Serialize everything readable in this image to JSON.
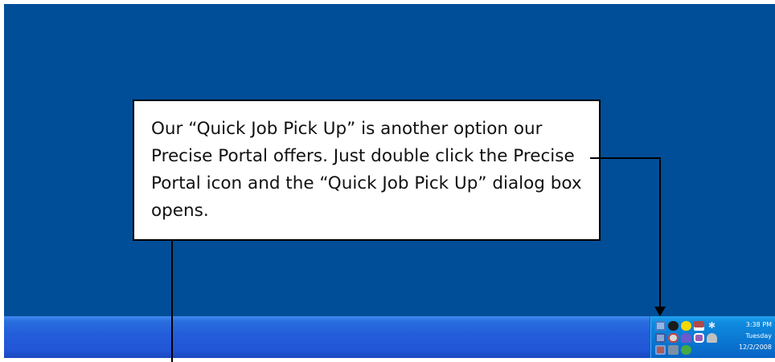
{
  "callout": {
    "text": "Our “Quick Job Pick Up” is another option our Precise Portal offers. Just double click the Precise Portal icon and the “Quick Job Pick Up” dialog box opens."
  },
  "clock": {
    "time": "3:38 PM",
    "day": "Tuesday",
    "date": "12/2/2008"
  },
  "tray_icons": [
    {
      "name": "network-icon",
      "color": "#8fb8e8"
    },
    {
      "name": "security-shield-icon",
      "color": "#1b1b1b"
    },
    {
      "name": "yellow-status-icon",
      "color": "#f5d800"
    },
    {
      "name": "app-icon",
      "color": "#b04a4a"
    },
    {
      "name": "bluetooth-icon",
      "color": "#2a52be"
    },
    {
      "name": "precise-portal-icon",
      "color": "#8aa6d6"
    },
    {
      "name": "globe-icon",
      "color": "#d9d9d9"
    },
    {
      "name": "user-icon",
      "color": "#6a5acd"
    },
    {
      "name": "device-icon",
      "color": "#9b59b6"
    },
    {
      "name": "network-cable-icon",
      "color": "#c0c0c0"
    },
    {
      "name": "monitor-icon",
      "color": "#b05a5a"
    },
    {
      "name": "printer-icon",
      "color": "#7b8fa8"
    },
    {
      "name": "refresh-icon",
      "color": "#44aa44"
    }
  ],
  "colors": {
    "desktop": "#004e98",
    "taskbar": "#245edb",
    "tray": "#0f8bde"
  }
}
